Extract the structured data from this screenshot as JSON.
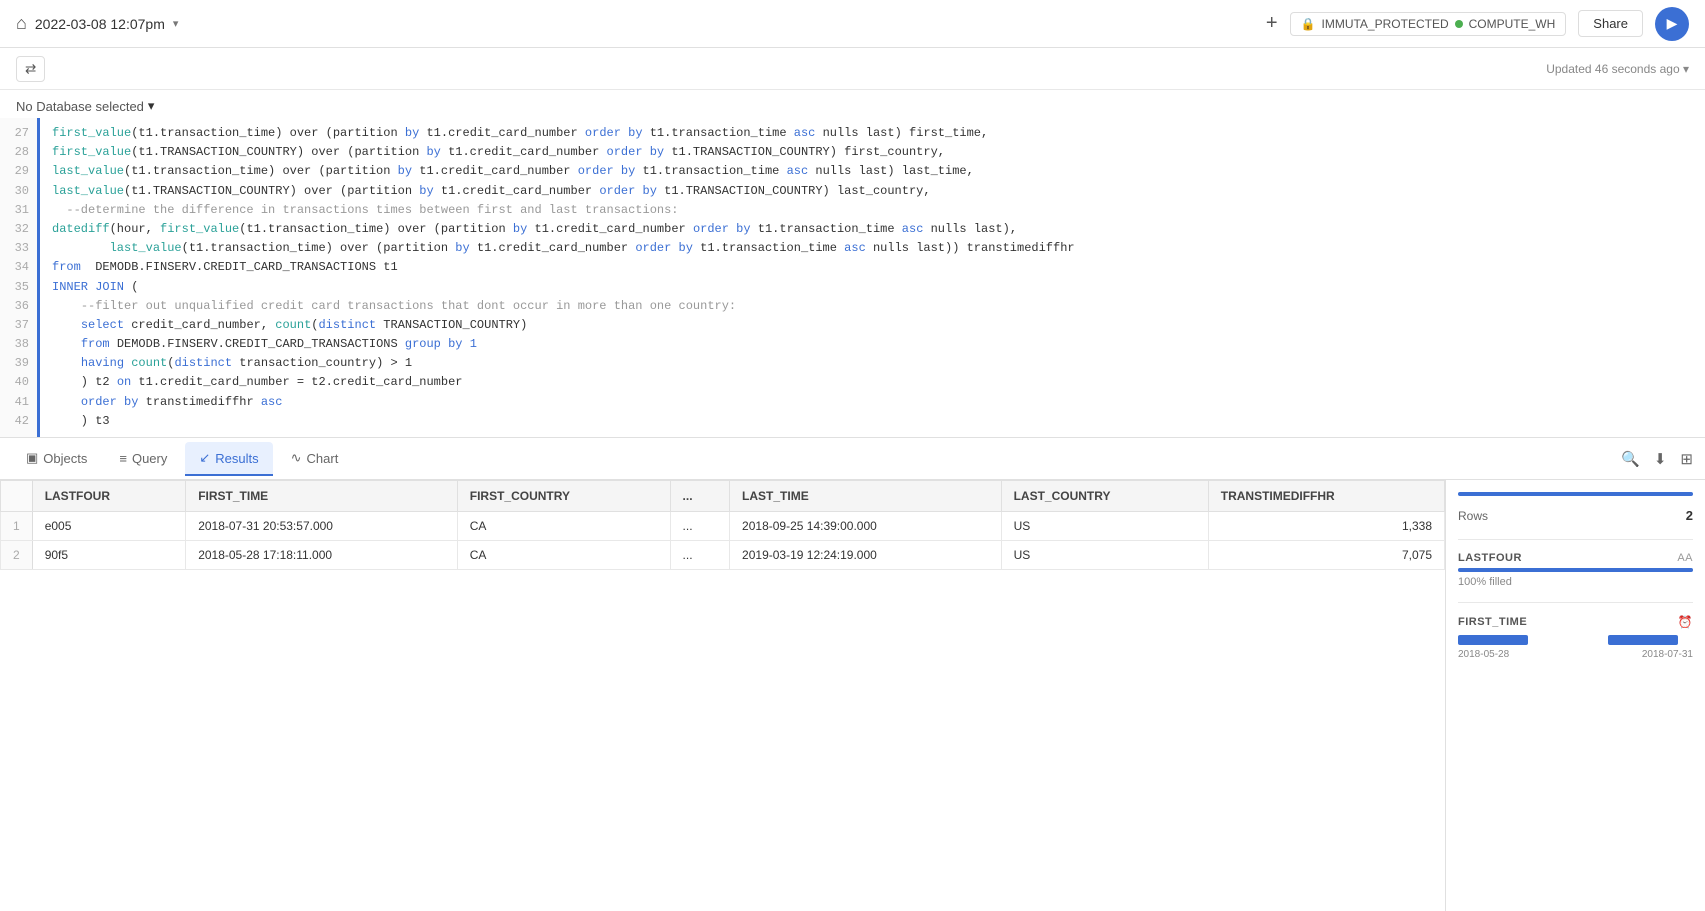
{
  "header": {
    "home_icon": "⌂",
    "title": "2022-03-08 12:07pm",
    "title_arrow": "▾",
    "plus": "+",
    "db_icon": "🔒",
    "db_name": "IMMUTA_PROTECTED",
    "warehouse": "COMPUTE_WH",
    "share_label": "Share",
    "run_icon": "▶",
    "updated": "Updated 46 seconds ago ▾"
  },
  "db_selector": {
    "label": "No Database selected",
    "arrow": "▾"
  },
  "code": {
    "lines": [
      {
        "num": "27",
        "content": "  first_value(t1.transaction_time) over (partition by t1.credit_card_number order by t1.transaction_time asc nulls last) first_time,"
      },
      {
        "num": "28",
        "content": "  first_value(t1.TRANSACTION_COUNTRY) over (partition by t1.credit_card_number order by t1.TRANSACTION_COUNTRY) first_country,"
      },
      {
        "num": "29",
        "content": "  last_value(t1.transaction_time) over (partition by t1.credit_card_number order by t1.transaction_time asc nulls last) last_time,"
      },
      {
        "num": "30",
        "content": "  last_value(t1.TRANSACTION_COUNTRY) over (partition by t1.credit_card_number order by t1.TRANSACTION_COUNTRY) last_country,"
      },
      {
        "num": "31",
        "content": "  --determine the difference in transactions times between first and last transactions:"
      },
      {
        "num": "32",
        "content": "  datediff(hour, first_value(t1.transaction_time) over (partition by t1.credit_card_number order by t1.transaction_time asc nulls last),"
      },
      {
        "num": "33",
        "content": "          last_value(t1.transaction_time) over (partition by t1.credit_card_number order by t1.transaction_time asc nulls last)) transtimediffhr"
      },
      {
        "num": "34",
        "content": "from  DEMODB.FINSERV.CREDIT_CARD_TRANSACTIONS t1"
      },
      {
        "num": "35",
        "content": "INNER JOIN ("
      },
      {
        "num": "36",
        "content": "    --filter out unqualified credit card transactions that dont occur in more than one country:"
      },
      {
        "num": "37",
        "content": "    select credit_card_number, count(distinct TRANSACTION_COUNTRY)"
      },
      {
        "num": "38",
        "content": "    from DEMODB.FINSERV.CREDIT_CARD_TRANSACTIONS group by 1"
      },
      {
        "num": "39",
        "content": "    having count(distinct transaction_country) > 1"
      },
      {
        "num": "40",
        "content": "    ) t2 on t1.credit_card_number = t2.credit_card_number"
      },
      {
        "num": "41",
        "content": "    order by transtimediffhr asc"
      },
      {
        "num": "42",
        "content": "    ) t3"
      }
    ]
  },
  "tabs": {
    "objects_label": "Objects",
    "query_label": "Query",
    "results_label": "Results",
    "chart_label": "Chart"
  },
  "table": {
    "headers": [
      "LASTFOUR",
      "FIRST_TIME",
      "FIRST_COUNTRY",
      "...",
      "LAST_TIME",
      "LAST_COUNTRY",
      "TRANSTIMEDIFFHR"
    ],
    "rows": [
      {
        "num": "1",
        "lastfour": "e005",
        "first_time": "2018-07-31 20:53:57.000",
        "first_country": "CA",
        "dots": "...",
        "last_time": "2018-09-25 14:39:00.000",
        "last_country": "US",
        "diff": "1,338"
      },
      {
        "num": "2",
        "lastfour": "90f5",
        "first_time": "2018-05-28 17:18:11.000",
        "first_country": "CA",
        "dots": "...",
        "last_time": "2019-03-19 12:24:19.000",
        "last_country": "US",
        "diff": "7,075"
      }
    ]
  },
  "sidebar": {
    "rows_label": "Rows",
    "rows_value": "2",
    "lastfour_label": "LASTFOUR",
    "lastfour_type": "Aa",
    "lastfour_fill": "100% filled",
    "lastfour_fill_pct": 100,
    "first_time_label": "FIRST_TIME",
    "first_time_date1": "2018-05-28",
    "first_time_date2": "2018-07-31"
  }
}
